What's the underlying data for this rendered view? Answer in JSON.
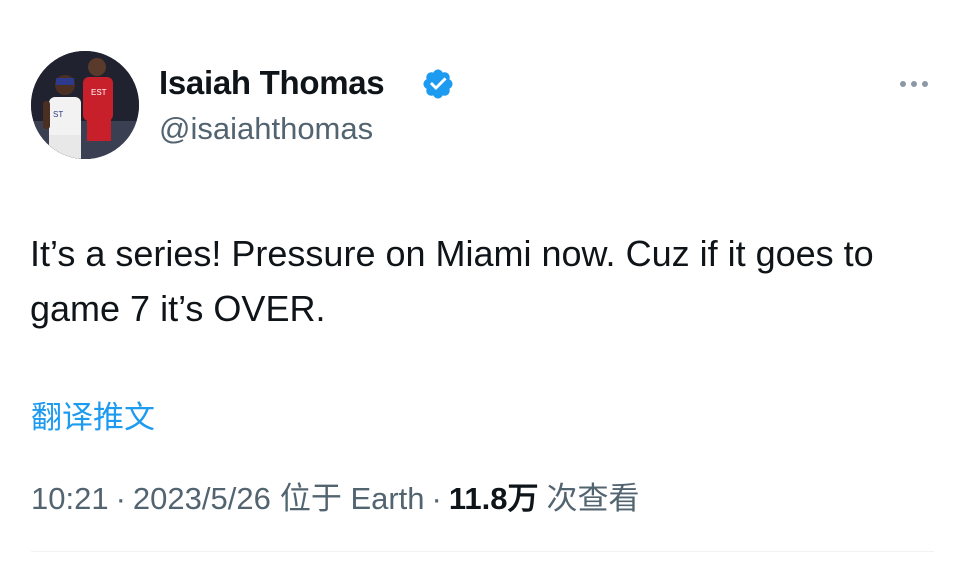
{
  "author": {
    "display_name": "Isaiah Thomas",
    "handle": "@isaiahthomas",
    "verified": true,
    "avatar_icon": "profile-photo",
    "verified_icon": "verified-badge-icon"
  },
  "tweet": {
    "text": "It’s a series! Pressure on Miami now. Cuz if it goes to game 7 it’s OVER.",
    "translate_label": "翻译推文"
  },
  "meta": {
    "time": "10:21",
    "date": "2023/5/26",
    "location": "位于 Earth",
    "views_count": "11.8万",
    "views_label": "次查看",
    "separator": "·"
  },
  "colors": {
    "accent": "#1d9bf0",
    "secondary_text": "#536471",
    "primary_text": "#0f1419"
  }
}
